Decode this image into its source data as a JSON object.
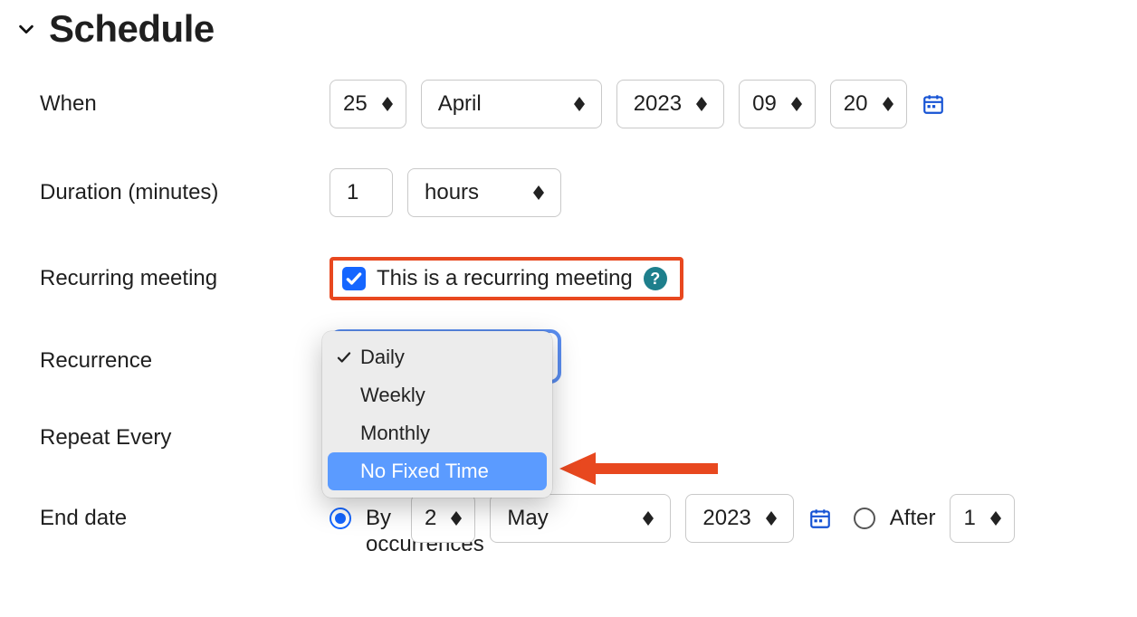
{
  "section_title": "Schedule",
  "labels": {
    "when": "When",
    "duration": "Duration (minutes)",
    "recurring": "Recurring meeting",
    "recurrence": "Recurrence",
    "repeat_every": "Repeat Every",
    "end_date": "End date"
  },
  "when": {
    "day": "25",
    "month": "April",
    "year": "2023",
    "hour": "09",
    "minute": "20"
  },
  "duration": {
    "value": "1",
    "unit": "hours"
  },
  "recurring": {
    "checkbox_label": "This is a recurring meeting"
  },
  "recurrence_options": {
    "o0": "Daily",
    "o1": "Weekly",
    "o2": "Monthly",
    "o3": "No Fixed Time"
  },
  "end_date": {
    "by_label": "By",
    "by_day": "2",
    "by_month": "May",
    "by_year": "2023",
    "after_label": "After",
    "after_count": "1",
    "occurrences_label": "occurrences"
  }
}
